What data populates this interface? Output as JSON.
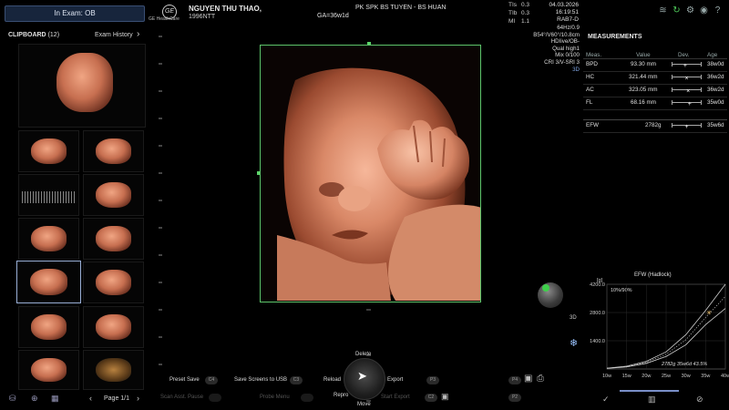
{
  "header": {
    "exam_status": "In Exam: OB",
    "brand": "GE HealthCare",
    "patient_name": "NGUYEN THU THAO,",
    "patient_id": "1996NTT",
    "ga": "GA=36w1d",
    "clinic": "PK SPK BS TUYEN - BS HUAN",
    "tis_label": "TIs",
    "tis_value": "0.3",
    "tib_label": "TIb",
    "tib_value": "0.3",
    "mi_label": "MI",
    "mi_value": "1.1",
    "date": "04.03.2026",
    "time": "16:19:51",
    "probe": "RAB7-D"
  },
  "probe_params": [
    "64Hz/0.9",
    "B54°/V60°/10.8cm",
    "HDIive/OB-",
    "Qual high1",
    "Mix 0/100",
    "CRI 3/V-SRI 3",
    "3D"
  ],
  "top_icons": [
    "wifi-icon",
    "refresh-icon",
    "settings-icon",
    "user-icon",
    "help-icon"
  ],
  "clipboard": {
    "title": "CLIPBOARD",
    "count": "(12)",
    "exam_history": "Exam History",
    "page": "Page 1/1"
  },
  "measurements": {
    "title": "MEASUREMENTS",
    "headers": [
      "Meas.",
      "Value",
      "Dev.",
      "Age"
    ],
    "rows": [
      {
        "name": "BPD",
        "value": "93.30 mm",
        "age": "38w0d",
        "dev": 0.45
      },
      {
        "name": "HC",
        "value": "321.44 mm",
        "age": "36w2d",
        "dev": 0.5
      },
      {
        "name": "AC",
        "value": "323.05 mm",
        "age": "36w2d",
        "dev": 0.55
      },
      {
        "name": "FL",
        "value": "68.16 mm",
        "age": "35w0d",
        "dev": 0.6
      }
    ],
    "efw": {
      "name": "EFW",
      "value": "2782g",
      "age": "35w6d",
      "dev": 0.5
    }
  },
  "efw_chart": {
    "title": "EFW (Hadlock)",
    "unit_label": "[g]",
    "percentile_label": "10%/90%",
    "annotation": "2782g 35w6d 43.5%"
  },
  "chart_data": {
    "type": "line",
    "title": "EFW (Hadlock)",
    "xlabel": "",
    "ylabel": "[g]",
    "x_ticks": [
      "10w",
      "15w",
      "20w",
      "25w",
      "30w",
      "35w",
      "40w"
    ],
    "y_ticks": [
      "1400.0",
      "2800.0",
      "4200.0"
    ],
    "xlim": [
      10,
      40
    ],
    "ylim": [
      0,
      4200
    ],
    "series": [
      {
        "name": "10%",
        "x": [
          10,
          15,
          20,
          25,
          30,
          35,
          40
        ],
        "y": [
          30,
          100,
          280,
          620,
          1200,
          2200,
          3000
        ]
      },
      {
        "name": "50%",
        "x": [
          10,
          15,
          20,
          25,
          30,
          35,
          40
        ],
        "y": [
          35,
          120,
          330,
          730,
          1450,
          2550,
          3600
        ]
      },
      {
        "name": "90%",
        "x": [
          10,
          15,
          20,
          25,
          30,
          35,
          40
        ],
        "y": [
          40,
          140,
          380,
          850,
          1700,
          2900,
          4200
        ]
      }
    ],
    "points": [
      {
        "x": 35.86,
        "y": 2782
      }
    ]
  },
  "controls": {
    "delete": "Delete",
    "move": "Move",
    "repro": "Repro",
    "preset_save": "Preset Save",
    "save_screens": "Save Screens to USB",
    "reload": "Reload",
    "export": "Export",
    "scan_assist": "Scan Asst. Pause",
    "probe_menu": "Probe Menu",
    "start_export": "Start Export",
    "badge_c4": "C4",
    "badge_c3": "C3",
    "badge_c2": "C2",
    "badge_p3": "P3",
    "badge_p4": "P4",
    "badge_p2": "P2",
    "label_3d": "3D"
  }
}
